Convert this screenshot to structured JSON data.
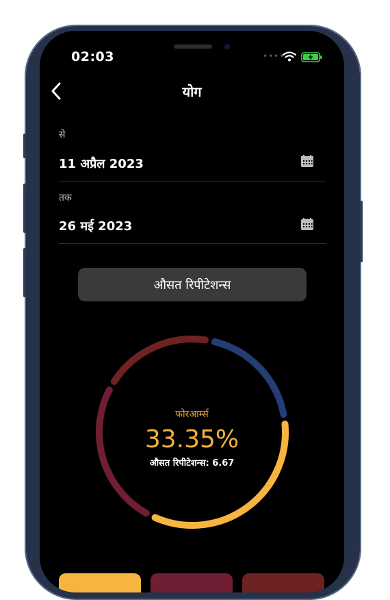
{
  "status_bar": {
    "time": "02:03"
  },
  "header": {
    "title": "योग"
  },
  "from_date": {
    "label": "से",
    "value": "11 अप्रैल 2023"
  },
  "to_date": {
    "label": "तक",
    "value": "26 मई 2023"
  },
  "average_button": {
    "label": "औसत रिपीटेशन्स"
  },
  "ring": {
    "category_label": "फोरआर्म्स",
    "percentage": "33.35%",
    "average_text": "औसत रिपीटेशन्स: 6.67",
    "segments": [
      {
        "name": "red",
        "color": "#6e2322",
        "share": 0.19
      },
      {
        "name": "blue",
        "color": "#243d74",
        "share": 0.19
      },
      {
        "name": "yellow",
        "color": "#f7b43f",
        "share": 0.3335
      },
      {
        "name": "maroon",
        "color": "#6f1e34",
        "share": 0.25
      }
    ]
  },
  "bottom_buttons": [
    {
      "name": "yellow",
      "color": "#f7b43f"
    },
    {
      "name": "maroon",
      "color": "#6f1e34"
    },
    {
      "name": "red",
      "color": "#6e2322"
    }
  ]
}
